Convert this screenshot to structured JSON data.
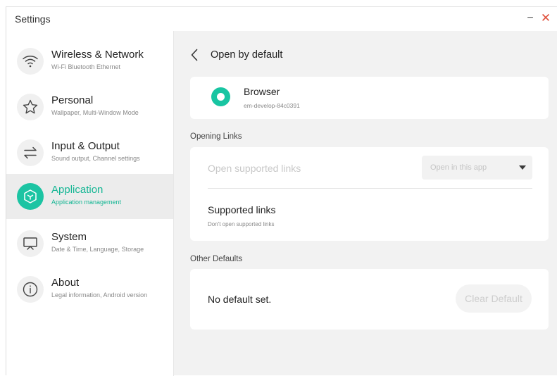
{
  "window": {
    "title": "Settings"
  },
  "sidebar": {
    "items": [
      {
        "title": "Wireless & Network",
        "subtitle": "Wi-Fi Bluetooth Ethernet",
        "icon": "wifi-icon"
      },
      {
        "title": "Personal",
        "subtitle": "Wallpaper, Multi-Window Mode",
        "icon": "star-icon"
      },
      {
        "title": "Input & Output",
        "subtitle": "Sound output, Channel settings",
        "icon": "swap-arrows-icon"
      },
      {
        "title": "Application",
        "subtitle": "Application management",
        "icon": "app-cube-icon",
        "active": true
      },
      {
        "title": "System",
        "subtitle": "Date & Time, Language, Storage",
        "icon": "display-icon"
      },
      {
        "title": "About",
        "subtitle": "Legal information, Android version",
        "icon": "info-icon"
      }
    ]
  },
  "main": {
    "title": "Open by default",
    "app": {
      "name": "Browser",
      "package": "em-develop-84c0391"
    },
    "opening_links": {
      "section_label": "Opening Links",
      "open_supported_label": "Open supported links",
      "dropdown_value": "Open in this app",
      "supported_title": "Supported links",
      "supported_subtitle": "Don't open supported links"
    },
    "other_defaults": {
      "section_label": "Other Defaults",
      "status": "No default set.",
      "clear_button": "Clear Default"
    }
  },
  "colors": {
    "accent": "#1cc4a3",
    "close": "#e0503c",
    "background": "#f2f2f2"
  }
}
